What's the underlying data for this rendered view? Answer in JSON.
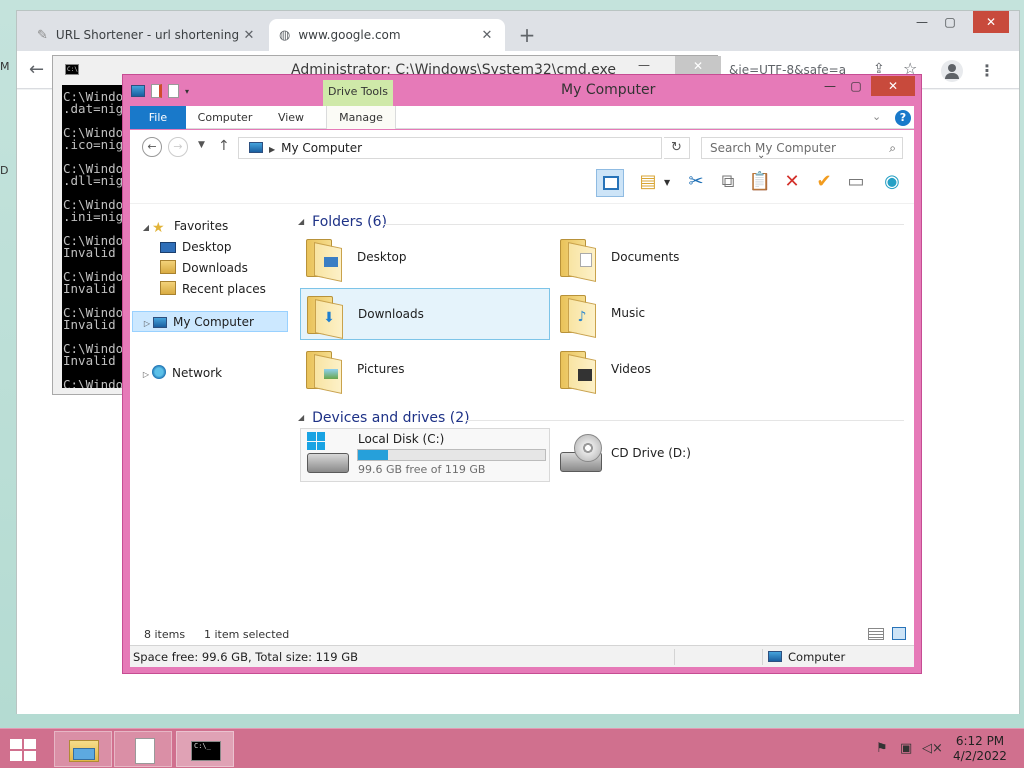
{
  "browser": {
    "tabs": [
      {
        "title": "URL Shortener - url shortening s",
        "icon": "url-shortener-favicon-icon"
      },
      {
        "title": "www.google.com",
        "icon": "globe-icon"
      }
    ],
    "new_tab": "+",
    "url_tail": "&ie=UTF-8&safe=a"
  },
  "cmd": {
    "title": "Administrator: C:\\Windows\\System32\\cmd.exe",
    "lines": [
      "C:\\Windo",
      ".dat=nig",
      "",
      "C:\\Windo",
      ".ico=nig",
      "",
      "C:\\Windo",
      ".dll=nig",
      "",
      "C:\\Windo",
      ".ini=nig",
      "",
      "C:\\Windo",
      "Invalid",
      "",
      "C:\\Windo",
      "Invalid",
      "",
      "C:\\Windo",
      "Invalid",
      "",
      "C:\\Windo",
      "Invalid",
      "",
      "C:\\Windo"
    ]
  },
  "explorer": {
    "title": "My Computer",
    "context_tab": "Drive Tools",
    "ribbon_tabs": {
      "file": "File",
      "computer": "Computer",
      "view": "View",
      "manage": "Manage"
    },
    "address": "My Computer",
    "search_placeholder": "Search My Computer",
    "nav": {
      "favorites": "Favorites",
      "desktop": "Desktop",
      "downloads": "Downloads",
      "recent": "Recent places",
      "my_computer": "My Computer",
      "network": "Network"
    },
    "folders_header": "Folders (6)",
    "folders": {
      "desktop": "Desktop",
      "documents": "Documents",
      "downloads": "Downloads",
      "music": "Music",
      "pictures": "Pictures",
      "videos": "Videos"
    },
    "devices_header": "Devices and drives (2)",
    "drives": {
      "c_name": "Local Disk (C:)",
      "c_free": "99.6 GB free of 119 GB",
      "c_used_fraction": 0.163,
      "d_name": "CD Drive (D:)"
    },
    "status": {
      "items": "8 items",
      "selected": "1 item selected"
    },
    "info": {
      "space": "Space free: 99.6 GB, Total size: 119 GB",
      "location": "Computer"
    }
  },
  "taskbar": {
    "time": "6:12 PM",
    "date": "4/2/2022"
  },
  "colors": {
    "accent": "#1979ca",
    "titlebar": "#e67ab8",
    "taskbar": "#d0708e",
    "close": "#c84a3c"
  }
}
